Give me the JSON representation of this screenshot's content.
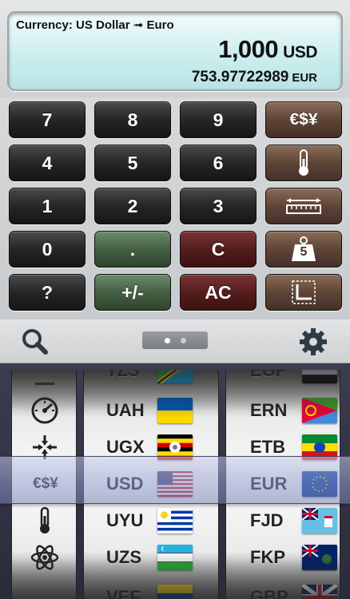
{
  "display": {
    "title": "Currency: US Dollar ➟ Euro",
    "main_value": "1,000",
    "main_unit": "USD",
    "result_value": "753.97722989",
    "result_unit": "EUR"
  },
  "keypad": {
    "k7": "7",
    "k8": "8",
    "k9": "9",
    "k4": "4",
    "k5": "5",
    "k6": "6",
    "k1": "1",
    "k2": "2",
    "k3": "3",
    "k0": "0",
    "dot": ".",
    "clear": "C",
    "help": "?",
    "sign": "+/-",
    "all_clear": "AC",
    "currency_label": "€$¥",
    "weight_label": "5"
  },
  "toolbar": {
    "icons": [
      "search-icon",
      "page-indicator",
      "gear-icon"
    ]
  },
  "picker": {
    "categories": [
      "speedometer-icon",
      "compress-arrows-icon",
      "currency-icon",
      "thermometer-icon",
      "atom-icon"
    ],
    "category_selected_label": "€$¥",
    "from_codes": [
      "UAH",
      "UGX",
      "USD",
      "UYU",
      "UZS"
    ],
    "to_codes": [
      "ERN",
      "ETB",
      "EUR",
      "FJD",
      "FKP"
    ],
    "partial_top_from": "TZS",
    "partial_top_to": "EGP",
    "partial_bot_from": "VEF",
    "partial_bot_to": "GBP"
  },
  "colors": {
    "display_bg": "#cdeeee",
    "key_dark": "#262626",
    "key_green": "#445f43",
    "key_red": "#551d1d",
    "key_brown": "#5e4535",
    "selection": "#9aa0cc"
  }
}
